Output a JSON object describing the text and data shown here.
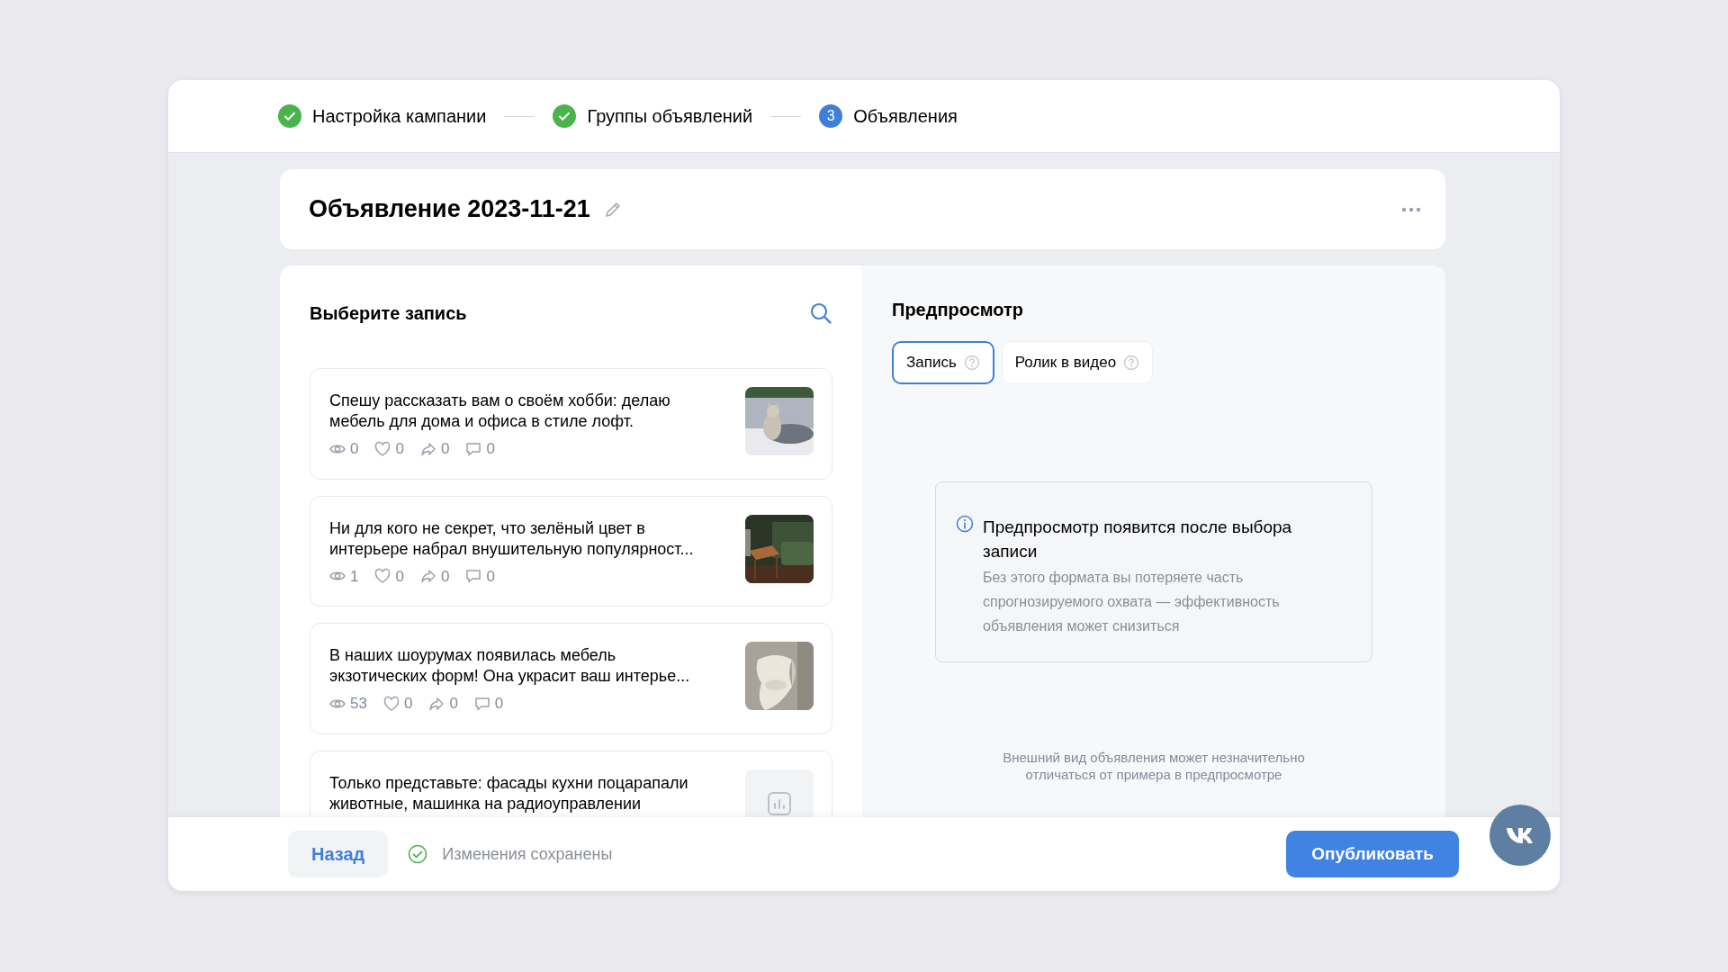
{
  "steps": [
    {
      "label": "Настройка кампании",
      "kind": "done"
    },
    {
      "label": "Группы объявлений",
      "kind": "done"
    },
    {
      "label": "Объявления",
      "kind": "current",
      "number": "3"
    }
  ],
  "ad": {
    "title": "Объявление 2023-11-21"
  },
  "posts_panel": {
    "title": "Выберите запись",
    "posts": [
      {
        "lines": [
          "Спешу рассказать вам о своём хобби: делаю",
          "мебель для дома и офиса в стиле лофт."
        ],
        "views": "0",
        "likes": "0",
        "shares": "0",
        "comments": "0"
      },
      {
        "lines": [
          "Ни для кого не секрет, что зелёный цвет в",
          "интерьере набрал внушительную популярност..."
        ],
        "views": "1",
        "likes": "0",
        "shares": "0",
        "comments": "0"
      },
      {
        "lines": [
          "В наших шоурумах появилась мебель",
          "экзотических форм! Она украсит ваш интерье..."
        ],
        "views": "53",
        "likes": "0",
        "shares": "0",
        "comments": "0"
      },
      {
        "lines": [
          "Только представьте: фасады кухни поцарапали",
          "животные, машинка на радиоуправлении"
        ],
        "kind": "placeholder"
      }
    ]
  },
  "preview": {
    "title": "Предпросмотр",
    "tabs": [
      {
        "label": "Запись",
        "selected": true
      },
      {
        "label": "Ролик в видео",
        "selected": false
      }
    ],
    "info": {
      "title": "Предпросмотр появится после выбора записи",
      "text": "Без этого формата вы потеряете часть спрогнозируемого охвата — эффективность объявления может снизиться"
    },
    "note": "Внешний вид объявления может незначительно отличаться от примера в предпросмотре"
  },
  "footer": {
    "back": "Назад",
    "saved": "Изменения сохранены",
    "publish": "Опубликовать"
  }
}
